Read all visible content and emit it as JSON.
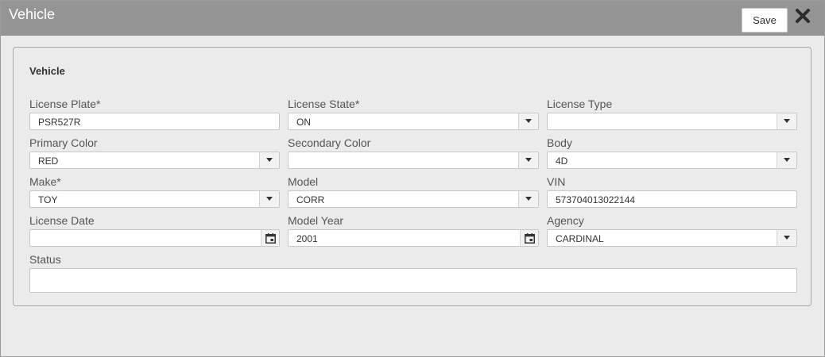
{
  "dialog": {
    "title": "Vehicle",
    "save_label": "Save"
  },
  "panel": {
    "section_title": "Vehicle"
  },
  "fields": {
    "license_plate": {
      "label": "License Plate*",
      "value": "PSR527R"
    },
    "license_state": {
      "label": "License State*",
      "value": "ON"
    },
    "license_type": {
      "label": "License Type",
      "value": ""
    },
    "primary_color": {
      "label": "Primary Color",
      "value": "RED"
    },
    "secondary_color": {
      "label": "Secondary Color",
      "value": ""
    },
    "body": {
      "label": "Body",
      "value": "4D"
    },
    "make": {
      "label": "Make*",
      "value": "TOY"
    },
    "model": {
      "label": "Model",
      "value": "CORR"
    },
    "vin": {
      "label": "VIN",
      "value": "573704013022144"
    },
    "license_date": {
      "label": "License Date",
      "value": ""
    },
    "model_year": {
      "label": "Model Year",
      "value": "2001"
    },
    "agency": {
      "label": "Agency",
      "value": "CARDINAL"
    },
    "status": {
      "label": "Status",
      "value": ""
    }
  },
  "icons": {
    "dropdown": "chevron-down-icon",
    "calendar": "calendar-icon",
    "close": "close-icon"
  }
}
